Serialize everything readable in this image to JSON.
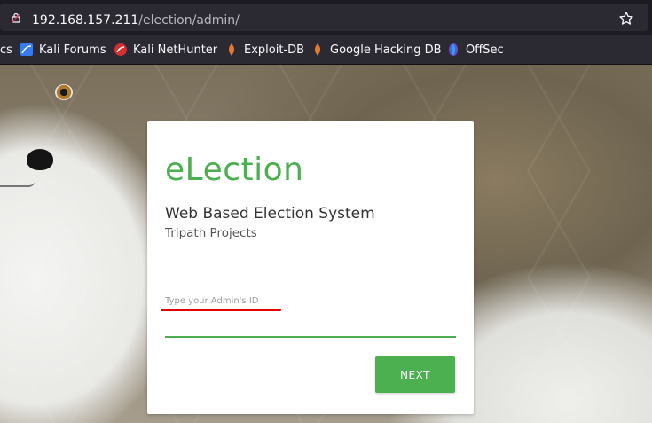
{
  "browser": {
    "url_host": "192.168.157.211",
    "url_path": "/election/admin/",
    "bookmarks": [
      {
        "label": "cs",
        "icon": "truncated-icon"
      },
      {
        "label": "Kali Forums",
        "icon": "kali-icon"
      },
      {
        "label": "Kali NetHunter",
        "icon": "nethunter-icon"
      },
      {
        "label": "Exploit-DB",
        "icon": "exploitdb-icon"
      },
      {
        "label": "Google Hacking DB",
        "icon": "ghdb-icon"
      },
      {
        "label": "OffSec",
        "icon": "offsec-icon"
      }
    ]
  },
  "card": {
    "title": "eLection",
    "subtitle": "Web Based Election System",
    "org": "Tripath Projects",
    "admin_id_placeholder": "Type your Admin's ID",
    "next_label": "NEXT"
  },
  "colors": {
    "accent": "#4caf50",
    "annotation_red": "#e30000"
  }
}
